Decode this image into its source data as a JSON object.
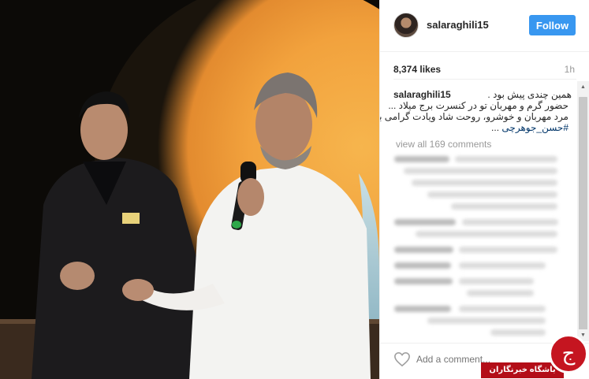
{
  "post": {
    "username": "salaraghili15",
    "follow_label": "Follow",
    "likes": "8,374 likes",
    "time": "1h",
    "caption_user": "salaraghili15",
    "caption_line1": "همین چندی پیش بود .",
    "caption_line2": "حضور گرم و مهربان تو در کنسرت برج میلاد ...",
    "caption_line3": "مرد مهربان و خوشرو، روحت شاد ویادت گرامی باد",
    "caption_tag": "#حسن_جوهرچی",
    "caption_ellipsis": "...",
    "view_all": "view all 169 comments",
    "add_comment_placeholder": "Add a comment..."
  },
  "watermark": {
    "label": "باشگاه خبرنگاران",
    "brand_color": "#c51520"
  },
  "icons": {
    "heart": "heart-icon",
    "avatar": "avatar",
    "scroll_up": "scroll-up-arrow-icon",
    "scroll_down": "scroll-down-arrow-icon"
  }
}
